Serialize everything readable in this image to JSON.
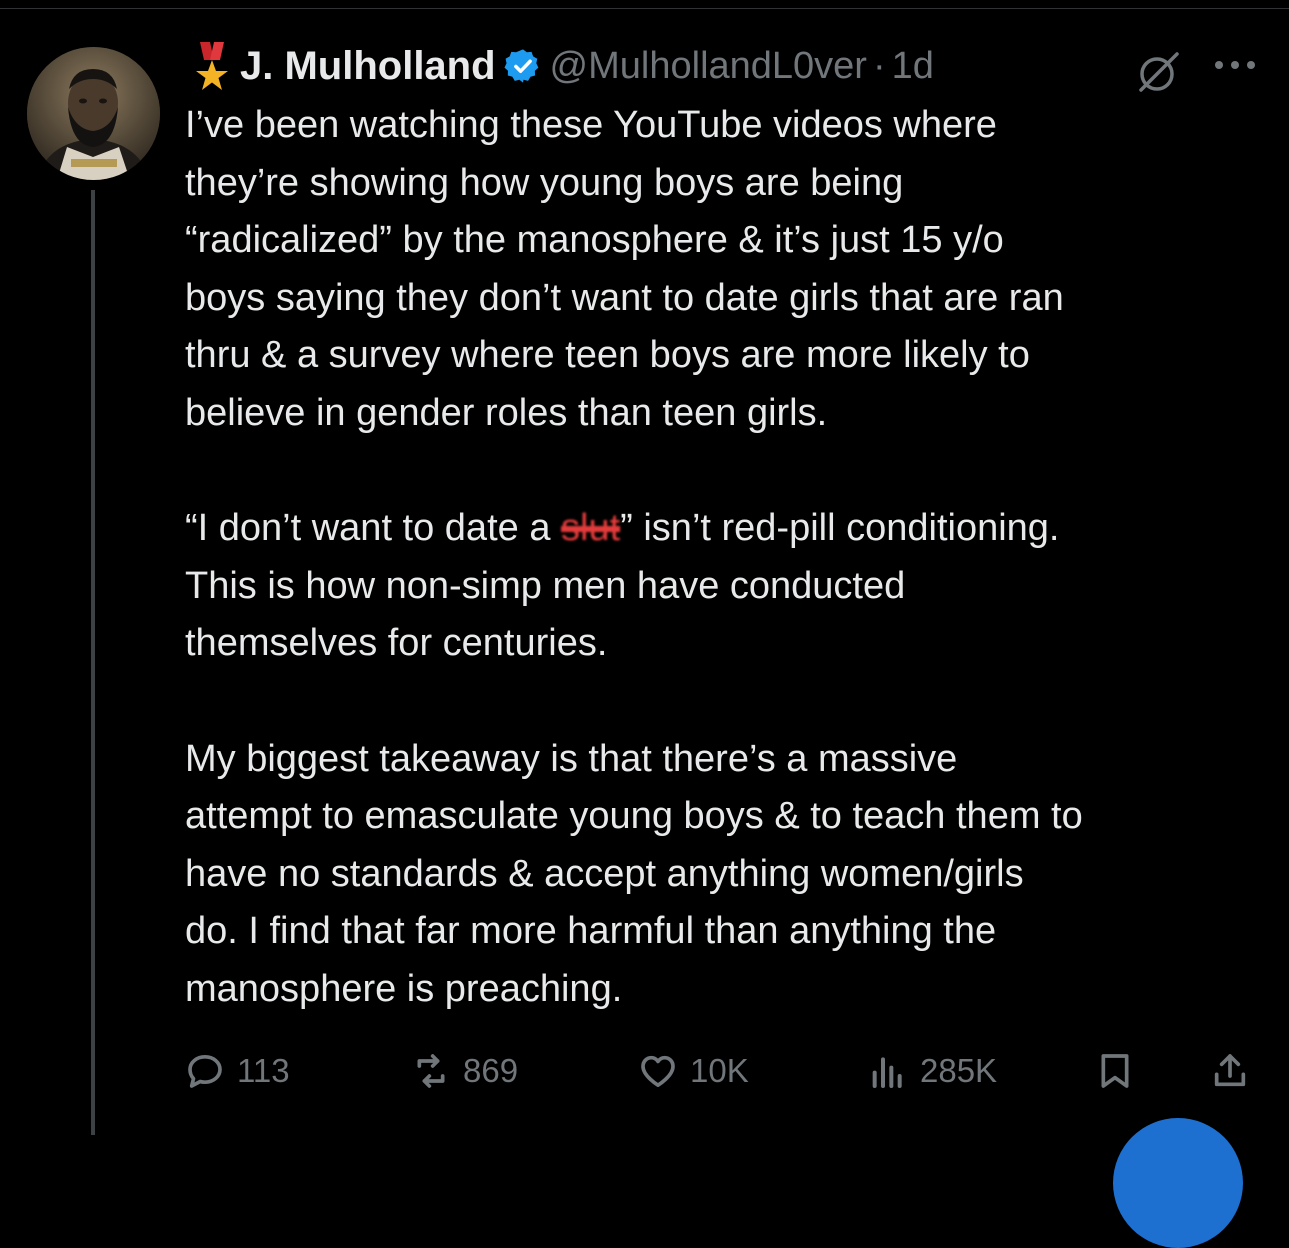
{
  "author": {
    "display_name": "J. Mulholland",
    "handle": "@MulhollandL0ver",
    "separator": "·",
    "time": "1d",
    "verified_color": "#1d9bf0"
  },
  "tweet": {
    "lines_p1": [
      "I’ve been watching these YouTube videos where",
      "they’re showing how young boys are being",
      "“radicalized” by the manosphere & it’s just 15 y/o",
      "boys saying they don’t want to date girls that are ran",
      "thru & a survey where teen boys are more likely to",
      "believe in gender roles than teen girls."
    ],
    "p2_line1_before": "“I don’t want to date a ",
    "p2_redacted": "slut",
    "p2_line1_after": "” isn’t red-pill conditioning.",
    "lines_p2_rest": [
      "This is how non-simp men have conducted",
      "themselves for centuries."
    ],
    "lines_p3": [
      "My biggest takeaway is that there’s a massive",
      "attempt to emasculate young boys & to teach them to",
      "have no standards & accept anything women/girls",
      "do. I find that far more harmful than anything the",
      "manosphere is preaching."
    ]
  },
  "actions": {
    "replies": "113",
    "reposts": "869",
    "likes": "10K",
    "views": "285K"
  },
  "icons": [
    "medal-icon",
    "verified-icon",
    "grok-icon",
    "more-icon",
    "reply-icon",
    "repost-icon",
    "like-icon",
    "views-icon",
    "bookmark-icon",
    "share-icon"
  ]
}
